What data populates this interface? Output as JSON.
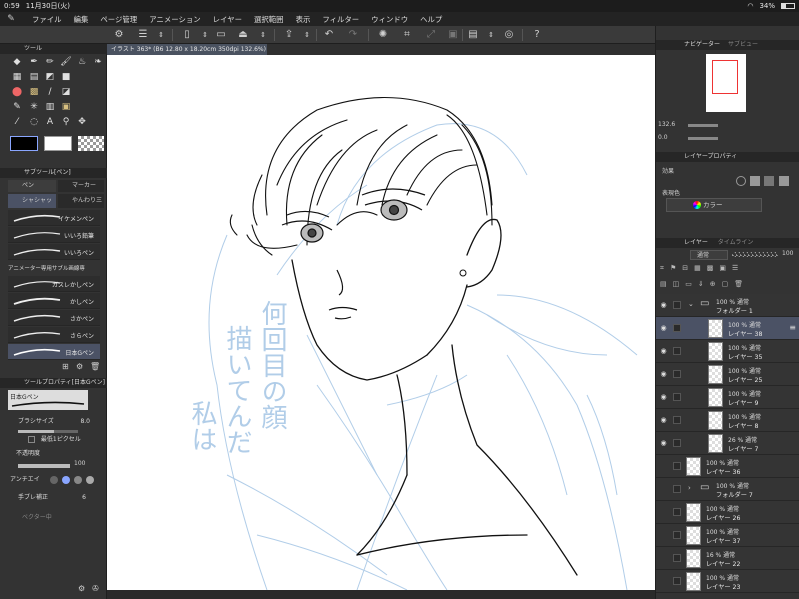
{
  "status": {
    "time": "0:59",
    "date": "11月30日(火)",
    "battery": "34%"
  },
  "menu": {
    "items": [
      "ファイル",
      "編集",
      "ページ管理",
      "アニメーション",
      "レイヤー",
      "選択範囲",
      "表示",
      "フィルター",
      "ウィンドウ",
      "ヘルプ"
    ]
  },
  "canvas": {
    "tab_title": "イラスト 363* (B6 12.80 x 18.20cm 350dpi 132.6%)",
    "handwritten_text": [
      "何回目の顔",
      "描いてんだ",
      "私は"
    ]
  },
  "tool_panel": {
    "title": "ツール"
  },
  "subtool_panel": {
    "title": "サブツール[ペン]",
    "tabs": [
      "ペン",
      "マーカー"
    ],
    "group_tabs": [
      "シャシャッ",
      "やんわり三"
    ],
    "group_label": "アニメーター専用サブル画線専",
    "brushes_top": [
      "イケメンペン",
      "いいろ鉛筆",
      "いいろペン"
    ],
    "brushes_bottom": [
      "ガスレかしペン",
      "かしペン",
      "さかペン",
      "さらペン",
      "日本Gペン"
    ]
  },
  "tool_property": {
    "title": "ツールプロパティ[日本Gペン]",
    "name": "日本Gペン",
    "brush_size_label": "ブラシサイズ",
    "brush_size": "8.0",
    "min_pixel_label": "最低1ピクセル",
    "opacity_label": "不透明度",
    "opacity": "100",
    "antialias_label": "アンチエイ",
    "stabilize_label": "手ブレ補正",
    "stabilize": "6",
    "vector_label": "ベクター中"
  },
  "navigator": {
    "tabs": [
      "ナビゲーター",
      "サブビュー"
    ],
    "zoom": "132.6",
    "angle": "0.0"
  },
  "layer_property": {
    "title": "レイヤープロパティ",
    "effect_label": "効果",
    "express_color_label": "表現色",
    "express_color_value": "カラー"
  },
  "layer_panel": {
    "tabs": [
      "レイヤー",
      "タイムライン"
    ],
    "blend_mode": "通常",
    "opacity": "100",
    "layers": [
      {
        "pct": "100 %",
        "mode": "通常",
        "name": "フォルダー 1",
        "kind": "folder",
        "indent": 0,
        "visible": true,
        "selected": false
      },
      {
        "pct": "100 %",
        "mode": "通常",
        "name": "レイヤー 38",
        "kind": "layer",
        "indent": 1,
        "visible": true,
        "selected": true
      },
      {
        "pct": "100 %",
        "mode": "通常",
        "name": "レイヤー 35",
        "kind": "layer",
        "indent": 1,
        "visible": true,
        "selected": false
      },
      {
        "pct": "100 %",
        "mode": "通常",
        "name": "レイヤー 25",
        "kind": "layer",
        "indent": 1,
        "visible": true,
        "selected": false
      },
      {
        "pct": "100 %",
        "mode": "通常",
        "name": "レイヤー 9",
        "kind": "layer",
        "indent": 1,
        "visible": true,
        "selected": false
      },
      {
        "pct": "100 %",
        "mode": "通常",
        "name": "レイヤー 8",
        "kind": "layer",
        "indent": 1,
        "visible": true,
        "selected": false
      },
      {
        "pct": "26 %",
        "mode": "通常",
        "name": "レイヤー 7",
        "kind": "layer",
        "indent": 1,
        "visible": true,
        "selected": false
      },
      {
        "pct": "100 %",
        "mode": "通常",
        "name": "レイヤー 36",
        "kind": "layer",
        "indent": 0,
        "visible": false,
        "selected": false
      },
      {
        "pct": "100 %",
        "mode": "通常",
        "name": "フォルダー 7",
        "kind": "folder",
        "indent": 0,
        "visible": false,
        "selected": false
      },
      {
        "pct": "100 %",
        "mode": "通常",
        "name": "レイヤー 26",
        "kind": "layer",
        "indent": 0,
        "visible": false,
        "selected": false
      },
      {
        "pct": "100 %",
        "mode": "通常",
        "name": "レイヤー 37",
        "kind": "layer",
        "indent": 0,
        "visible": false,
        "selected": false
      },
      {
        "pct": "16 %",
        "mode": "通常",
        "name": "レイヤー 22",
        "kind": "layer",
        "indent": 0,
        "visible": false,
        "selected": false
      },
      {
        "pct": "100 %",
        "mode": "通常",
        "name": "レイヤー 23",
        "kind": "layer",
        "indent": 0,
        "visible": false,
        "selected": false
      }
    ]
  },
  "colors": {
    "accent": "#4b5265",
    "panel": "#333333",
    "canvas": "#ffffff",
    "sketch_blue": "#a9c8e6"
  }
}
